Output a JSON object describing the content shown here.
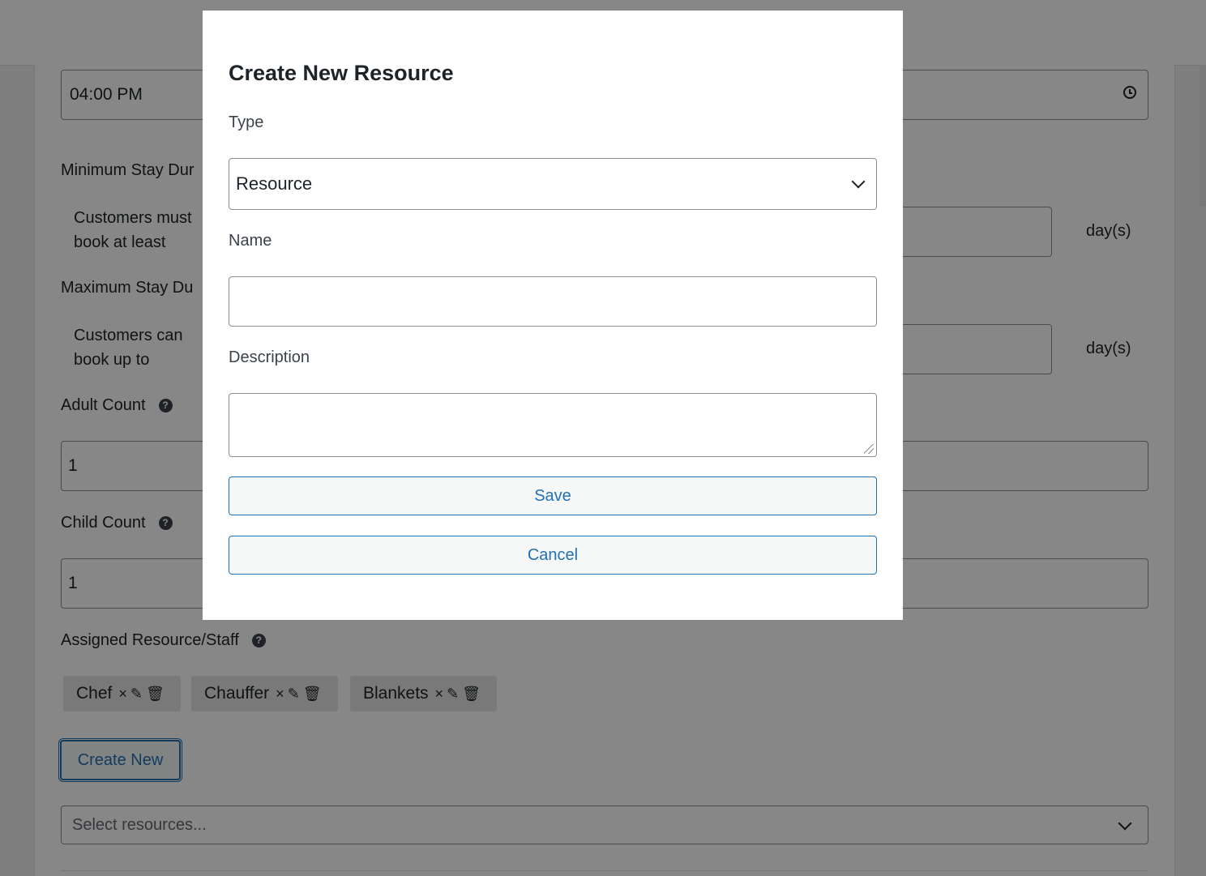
{
  "background": {
    "time_value": "04:00 PM",
    "min_stay": {
      "label": "Minimum Stay Dur",
      "desc_line1": "Customers must",
      "desc_line2": "book at least",
      "unit": "day(s)"
    },
    "max_stay": {
      "label": "Maximum Stay Du",
      "desc_line1": "Customers can",
      "desc_line2": "book up to",
      "unit": "day(s)"
    },
    "adult_count": {
      "label": "Adult Count",
      "value": "1"
    },
    "child_count": {
      "label": "Child Count",
      "value": "1"
    },
    "assigned": {
      "label": "Assigned Resource/Staff",
      "chips": [
        {
          "name": "Chef",
          "remove": "×",
          "edit": "✎",
          "trash": "🗑"
        },
        {
          "name": "Chauffer",
          "remove": "×",
          "edit": "✎",
          "trash": "🗑"
        },
        {
          "name": "Blankets",
          "remove": "×",
          "edit": "✎",
          "trash": "🗑"
        }
      ]
    },
    "create_new_label": "Create New",
    "select_placeholder": "Select resources..."
  },
  "modal": {
    "title": "Create New Resource",
    "type_label": "Type",
    "type_value": "Resource",
    "name_label": "Name",
    "name_value": "",
    "description_label": "Description",
    "description_value": "",
    "save_label": "Save",
    "cancel_label": "Cancel"
  },
  "colors": {
    "accent": "#2271b1",
    "overlay": "#000000"
  }
}
